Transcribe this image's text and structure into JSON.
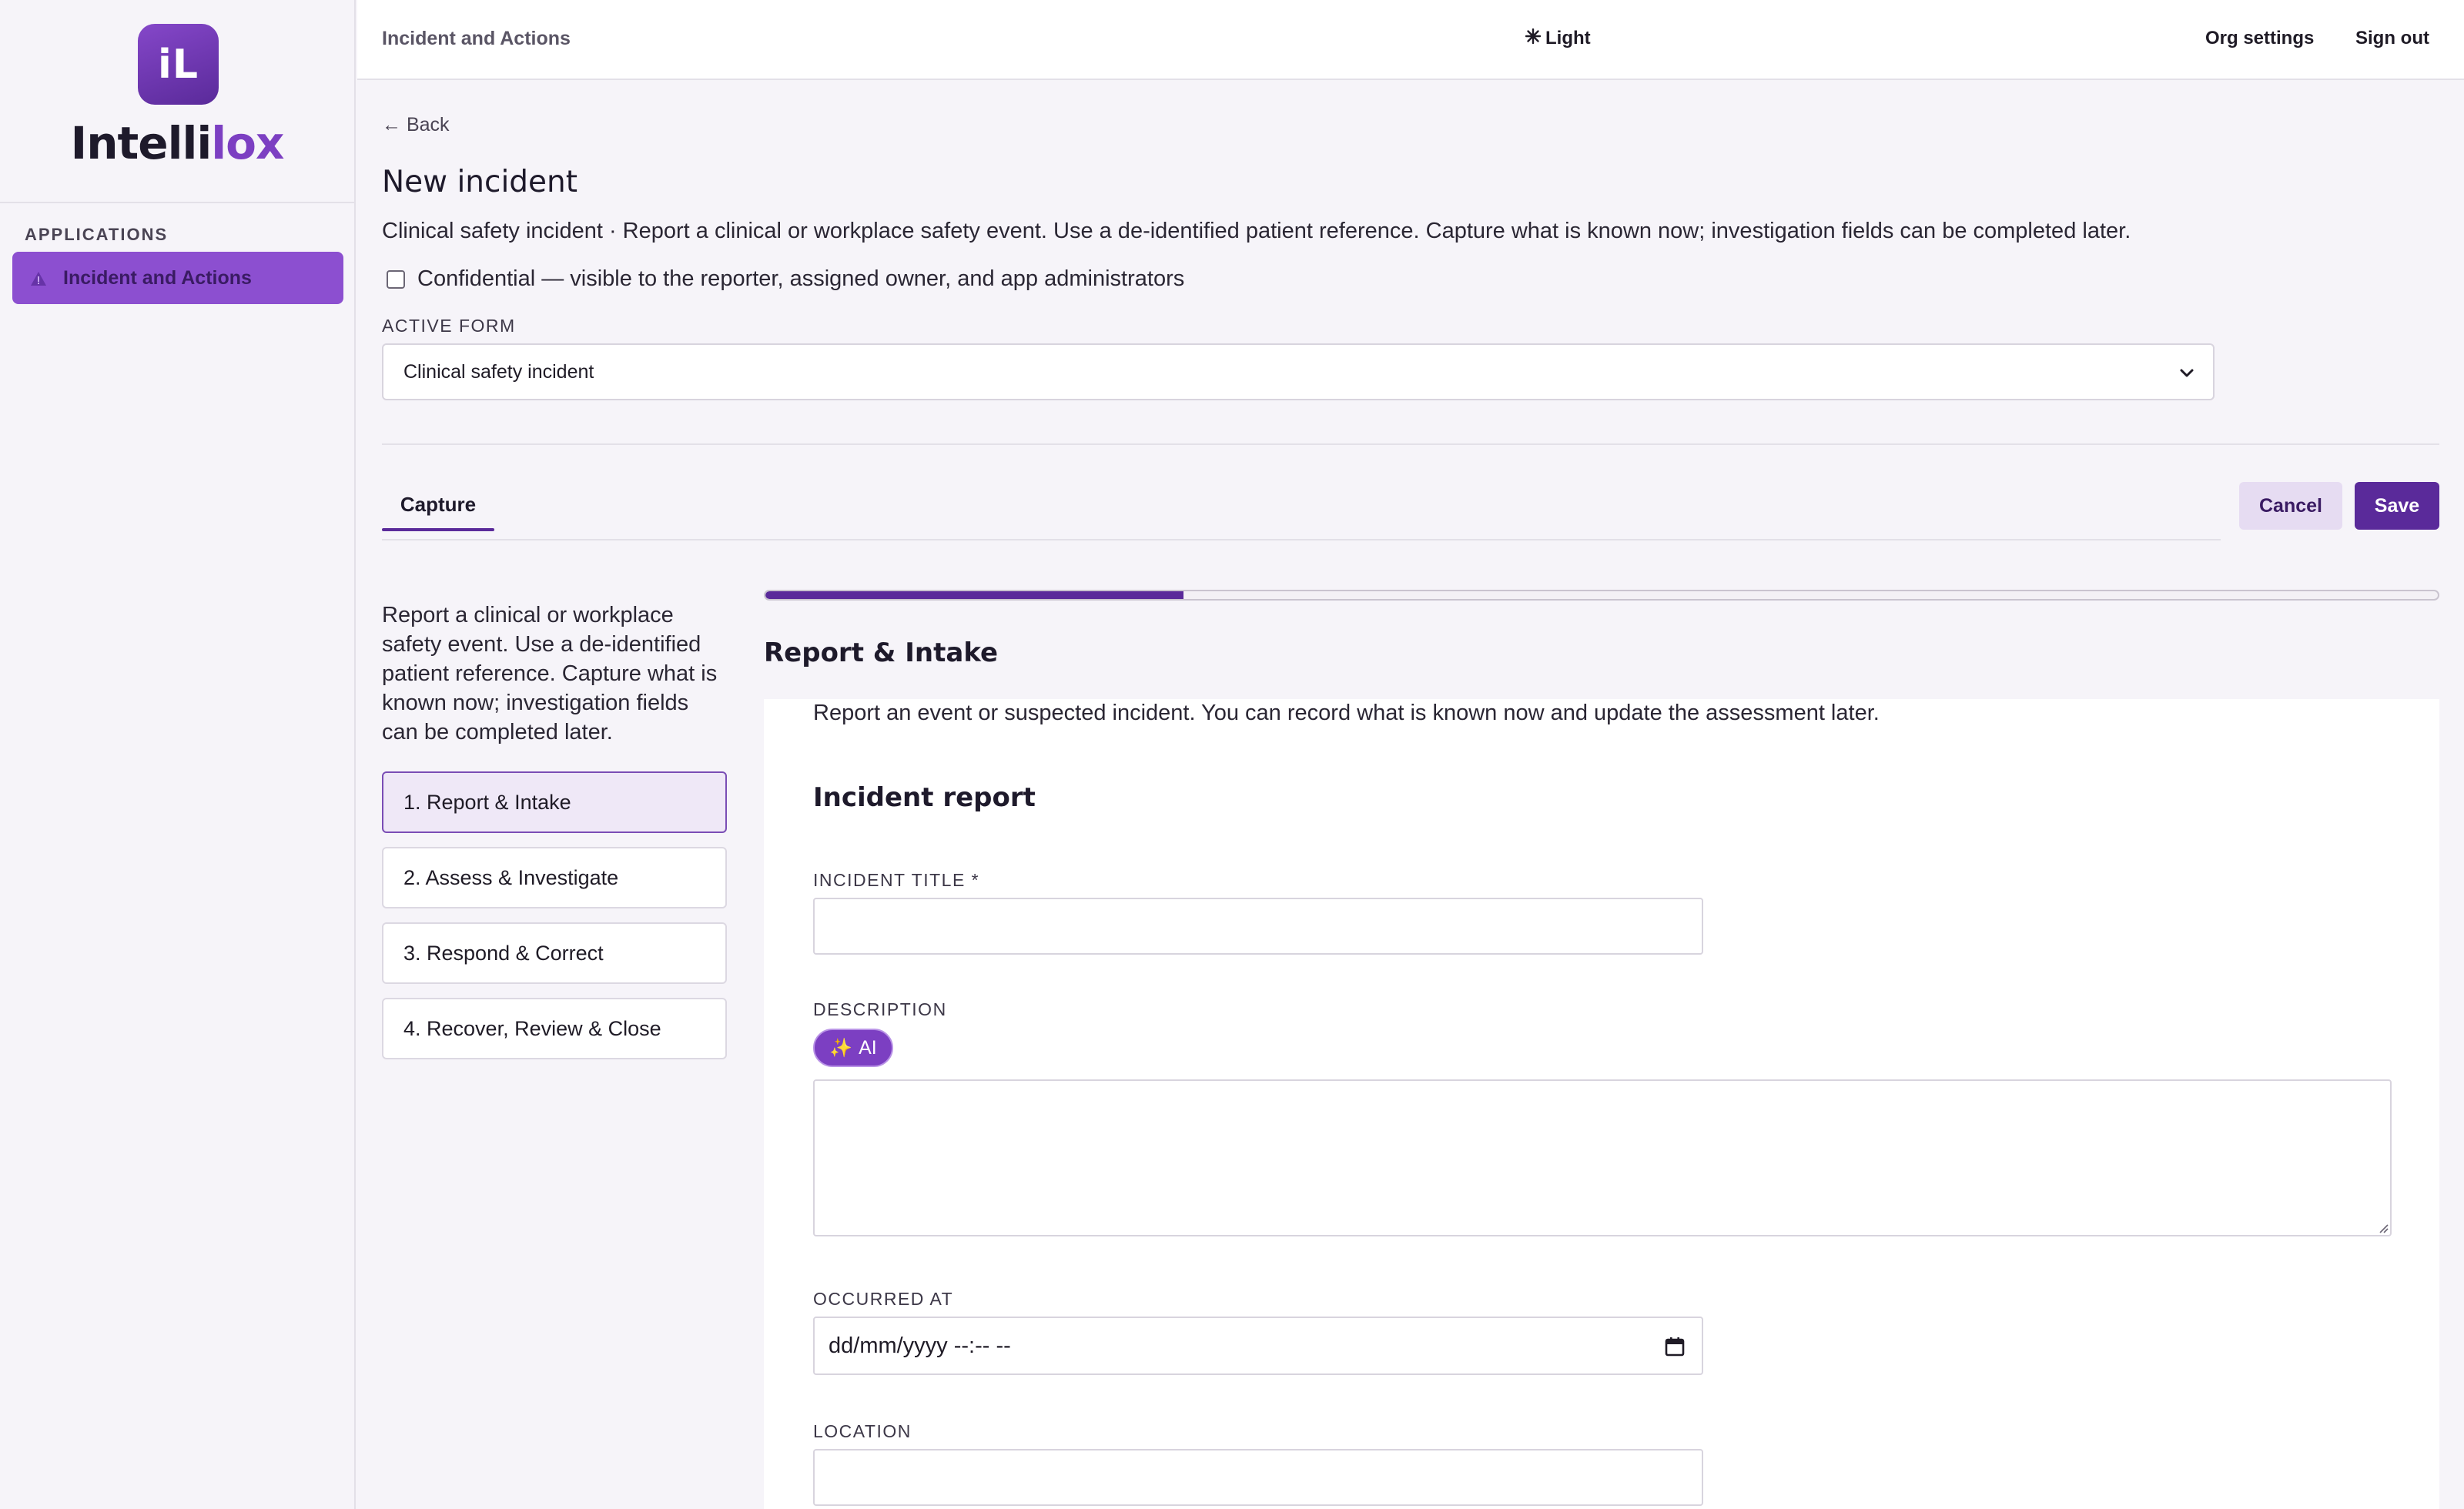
{
  "brand": {
    "badge": "iL",
    "name_main": "Intelli",
    "name_accent": "lox",
    "accent_color": "#7c3fc2"
  },
  "sidebar": {
    "heading": "APPLICATIONS",
    "items": [
      {
        "label": "Incident and Actions",
        "icon": "warning-icon",
        "active": true
      }
    ]
  },
  "topbar": {
    "title": "Incident and Actions",
    "theme_icon": "sun-icon",
    "theme_label": "Light",
    "org_settings": "Org settings",
    "sign_out": "Sign out"
  },
  "page": {
    "back": "← Back",
    "title": "New incident",
    "subtitle": "Clinical safety incident · Report a clinical or workplace safety event. Use a de-identified patient reference. Capture what is known now; investigation fields can be completed later.",
    "confidential_label": "Confidential — visible to the reporter, assigned owner, and app administrators",
    "confidential_checked": false,
    "active_form_label": "ACTIVE FORM",
    "active_form_value": "Clinical safety incident"
  },
  "tabs": [
    {
      "label": "Capture",
      "active": true
    }
  ],
  "actions": {
    "cancel": "Cancel",
    "save": "Save"
  },
  "steps_intro": "Report a clinical or workplace safety event. Use a de-identified patient reference. Capture what is known now; investigation fields can be completed later.",
  "steps": [
    {
      "label": "1. Report & Intake",
      "active": true
    },
    {
      "label": "2. Assess & Investigate",
      "active": false
    },
    {
      "label": "3. Respond & Correct",
      "active": false
    },
    {
      "label": "4. Recover, Review & Close",
      "active": false
    }
  ],
  "progress": {
    "fraction": 0.25,
    "color": "#5a2a9a"
  },
  "section": {
    "title": "Report & Intake",
    "intro": "Report an event or suspected incident. You can record what is known now and update the assessment later.",
    "card_heading": "Incident report"
  },
  "fields": {
    "title_label": "INCIDENT TITLE *",
    "title_value": "",
    "description_label": "DESCRIPTION",
    "ai_button": "AI",
    "ai_icon": "sparkles-icon",
    "description_value": "",
    "occurred_label": "OCCURRED AT",
    "occurred_placeholder": "dd/mm/yyyy --:-- --",
    "location_label": "LOCATION",
    "location_value": ""
  }
}
